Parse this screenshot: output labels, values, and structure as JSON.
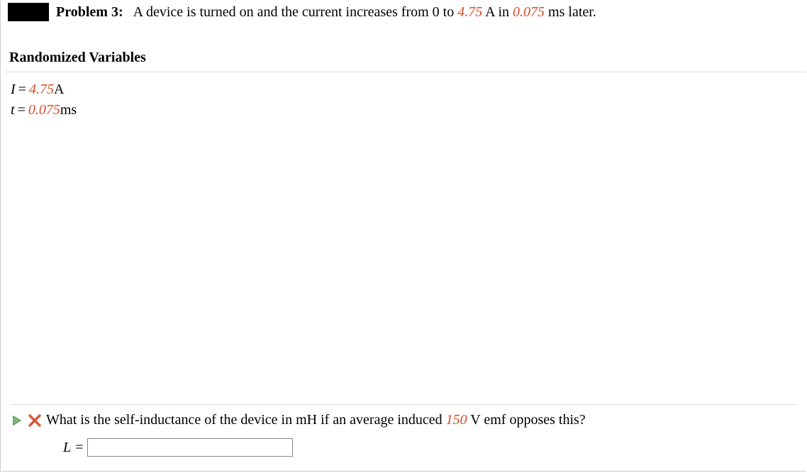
{
  "problem": {
    "label": "Problem 3:",
    "text_prefix": "A device is turned on and the current increases from 0 to ",
    "current_value": "4.75",
    "text_mid1": " A in ",
    "time_value": "0.075",
    "text_suffix": " ms later."
  },
  "rand_vars_label": "Randomized Variables",
  "variables": {
    "I": {
      "name": "I",
      "eq": "=",
      "value": "4.75",
      "unit": " A"
    },
    "t": {
      "name": "t",
      "eq": "=",
      "value": "0.075",
      "unit": " ms"
    }
  },
  "question": {
    "prefix": "What is the self-inductance of the device in mH if an average induced ",
    "emf_value": "150",
    "suffix": " V emf opposes this?"
  },
  "answer": {
    "label": "L",
    "eq": "=",
    "value": ""
  }
}
